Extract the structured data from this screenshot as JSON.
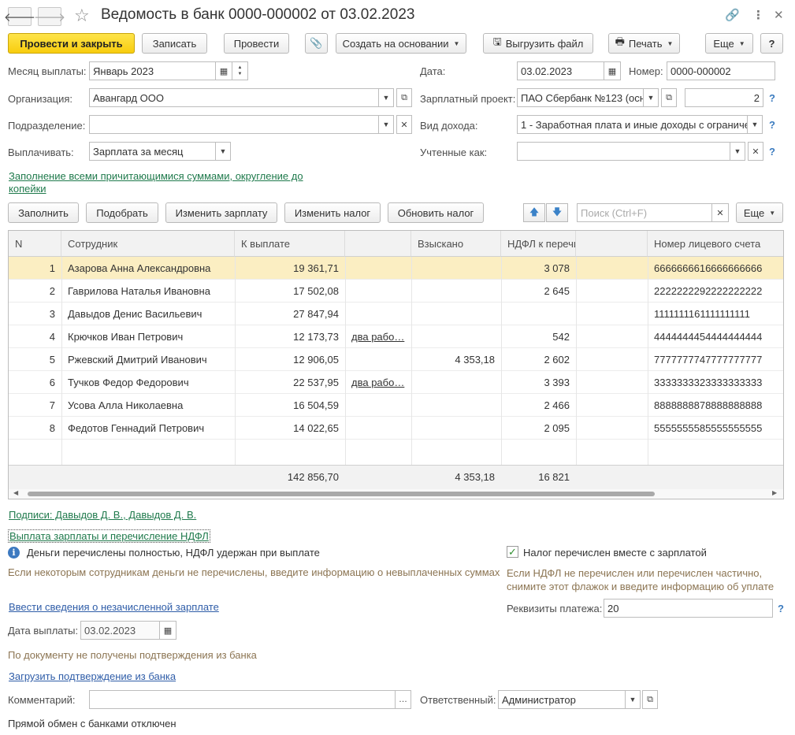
{
  "window": {
    "title": "Ведомость в банк 0000-000002 от 03.02.2023"
  },
  "toolbar": {
    "post_close": "Провести и закрыть",
    "save": "Записать",
    "post": "Провести",
    "create_based": "Создать на основании",
    "export_file": "Выгрузить файл",
    "print": "Печать",
    "more": "Еще",
    "help": "?"
  },
  "form": {
    "month_label": "Месяц выплаты:",
    "month_value": "Январь 2023",
    "date_label": "Дата:",
    "date_value": "03.02.2023",
    "number_label": "Номер:",
    "number_value": "0000-000002",
    "org_label": "Организация:",
    "org_value": "Авангард ООО",
    "salary_project_label": "Зарплатный проект:",
    "salary_project_value": "ПАО Сбербанк №123 (осн",
    "salary_project_count": "2",
    "dept_label": "Подразделение:",
    "dept_value": "",
    "income_type_label": "Вид дохода:",
    "income_type_value": "1 - Заработная плата и иные доходы с ограниче",
    "pay_label": "Выплачивать:",
    "pay_value": "Зарплата за месяц",
    "accounted_label": "Учтенные как:",
    "accounted_value": "",
    "fill_mode_link": "Заполнение всеми причитающимися суммами, округление до",
    "fill_mode_link_2": "копейки"
  },
  "table_toolbar": {
    "fill": "Заполнить",
    "select": "Подобрать",
    "change_salary": "Изменить зарплату",
    "change_tax": "Изменить налог",
    "update_tax": "Обновить налог",
    "search_placeholder": "Поиск (Ctrl+F)",
    "more": "Еще"
  },
  "table": {
    "headers": [
      "N",
      "Сотрудник",
      "К выплате",
      "",
      "Взыскано",
      "НДФЛ к перечислению",
      "",
      "Номер лицевого счета"
    ],
    "rows": [
      {
        "n": "1",
        "employee": "Азарова Анна Александровна",
        "amount": "19 361,71",
        "note": "",
        "withheld": "",
        "tax": "3 078",
        "account": "6666666616666666666"
      },
      {
        "n": "2",
        "employee": "Гаврилова Наталья Ивановна",
        "amount": "17 502,08",
        "note": "",
        "withheld": "",
        "tax": "2 645",
        "account": "2222222292222222222"
      },
      {
        "n": "3",
        "employee": "Давыдов Денис Васильевич",
        "amount": "27 847,94",
        "note": "",
        "withheld": "",
        "tax": "",
        "account": "1111111161111111111"
      },
      {
        "n": "4",
        "employee": "Крючков Иван Петрович",
        "amount": "12 173,73",
        "note": "два рабо…",
        "withheld": "",
        "tax": "542",
        "account": "4444444454444444444"
      },
      {
        "n": "5",
        "employee": "Ржевский Дмитрий Иванович",
        "amount": "12 906,05",
        "note": "",
        "withheld": "4 353,18",
        "tax": "2 602",
        "account": "7777777747777777777"
      },
      {
        "n": "6",
        "employee": "Тучков Федор Федорович",
        "amount": "22 537,95",
        "note": "два рабо…",
        "withheld": "",
        "tax": "3 393",
        "account": "3333333323333333333"
      },
      {
        "n": "7",
        "employee": "Усова Алла Николаевна",
        "amount": "16 504,59",
        "note": "",
        "withheld": "",
        "tax": "2 466",
        "account": "8888888878888888888"
      },
      {
        "n": "8",
        "employee": "Федотов Геннадий Петрович",
        "amount": "14 022,65",
        "note": "",
        "withheld": "",
        "tax": "2 095",
        "account": "5555555585555555555"
      }
    ],
    "totals": {
      "amount": "142 856,70",
      "withheld": "4 353,18",
      "tax": "16 821"
    }
  },
  "bottom": {
    "signatures_link": "Подписи: Давыдов Д. В., Давыдов Д. В.",
    "payment_link": "Выплата зарплаты и перечисление НДФЛ",
    "money_status": "Деньги перечислены  полностью, НДФЛ удержан при выплате",
    "money_hint": "Если некоторым сотрудникам деньги не перечислены, введите информацию о невыплаченных суммах",
    "tax_checkbox": "Налог перечислен вместе с зарплатой",
    "tax_hint_1": "Если НДФЛ не перечислен или перечислен частично,",
    "tax_hint_2": "снимите этот флажок и введите информацию об уплате",
    "unpaid_link": "Ввести сведения о незачисленной зарплате",
    "requisites_label": "Реквизиты платежа:",
    "requisites_value": "20",
    "pay_date_label": "Дата выплаты:",
    "pay_date_value": "03.02.2023",
    "no_confirm": "По документу не получены подтверждения из банка",
    "load_confirm_link": "Загрузить подтверждение из банка",
    "comment_label": "Комментарий:",
    "comment_value": "",
    "responsible_label": "Ответственный:",
    "responsible_value": "Администратор",
    "direct_exchange": "Прямой обмен с банками отключен"
  }
}
